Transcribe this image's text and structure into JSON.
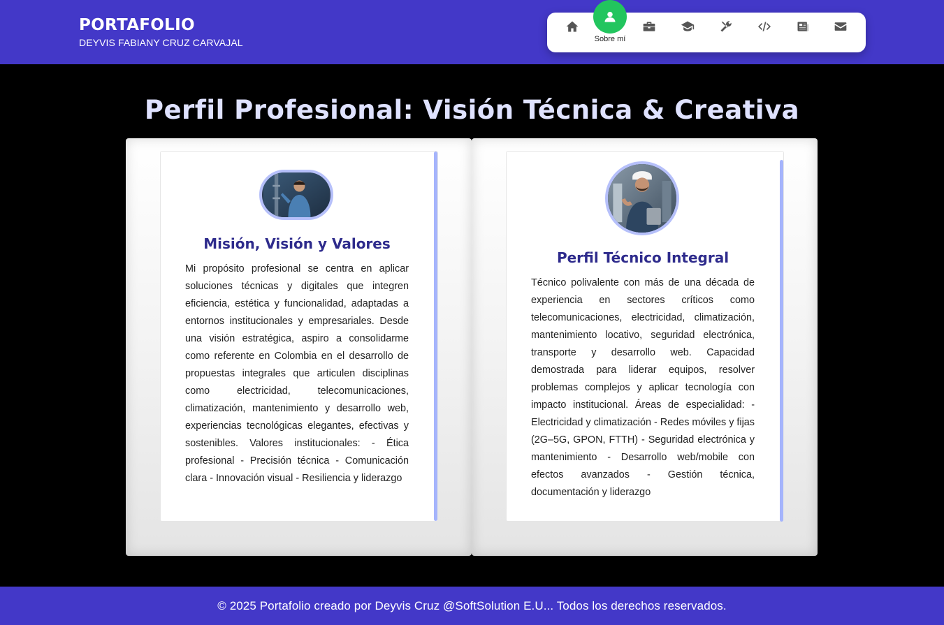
{
  "header": {
    "title": "PORTAFOLIO",
    "subtitle": "DEYVIS FABIANY CRUZ CARVAJAL"
  },
  "nav": {
    "items": [
      {
        "icon": "home-icon"
      },
      {
        "icon": "user-icon",
        "label": "Sobre mí",
        "active": true
      },
      {
        "icon": "briefcase-icon"
      },
      {
        "icon": "graduation-cap-icon"
      },
      {
        "icon": "tools-icon"
      },
      {
        "icon": "code-icon"
      },
      {
        "icon": "newspaper-icon"
      },
      {
        "icon": "envelope-icon"
      }
    ],
    "active_color": "#22c55e"
  },
  "main": {
    "title": "Perfil Profesional: Visión Técnica & Creativa",
    "cards": [
      {
        "title": "Misión, Visión y Valores",
        "text": "Mi propósito profesional se centra en aplicar soluciones técnicas y digitales que integren eficiencia, estética y funcionalidad, adaptadas a entornos institucionales y empresariales. Desde una visión estratégica, aspiro a consolidarme como referente en Colombia en el desarrollo de propuestas integrales que articulen disciplinas como electricidad, telecomunicaciones, climatización, mantenimiento y desarrollo web, experiencias tecnológicas elegantes, efectivas y sostenibles. Valores institucionales: - Ética profesional - Precisión técnica - Comunicación clara - Innovación visual - Resiliencia y liderazgo"
      },
      {
        "title": "Perfil Técnico Integral",
        "text": "Técnico polivalente con más de una década de experiencia en sectores críticos como telecomunicaciones, electricidad, climatización, mantenimiento locativo, seguridad electrónica, transporte y desarrollo web. Capacidad demostrada para liderar equipos, resolver problemas complejos y aplicar tecnología con impacto institucional. Áreas de especialidad: - Electricidad y climatización - Redes móviles y fijas (2G–5G, GPON, FTTH) - Seguridad electrónica y mantenimiento - Desarrollo web/mobile con efectos avanzados - Gestión técnica, documentación y liderazgo"
      }
    ]
  },
  "footer": {
    "text": "© 2025 Portafolio creado por Deyvis Cruz @SoftSolution E.U... Todos los derechos reservados."
  },
  "colors": {
    "primary": "#4338c8",
    "accent": "#a5b4fc",
    "card_title": "#2e2b8c"
  }
}
